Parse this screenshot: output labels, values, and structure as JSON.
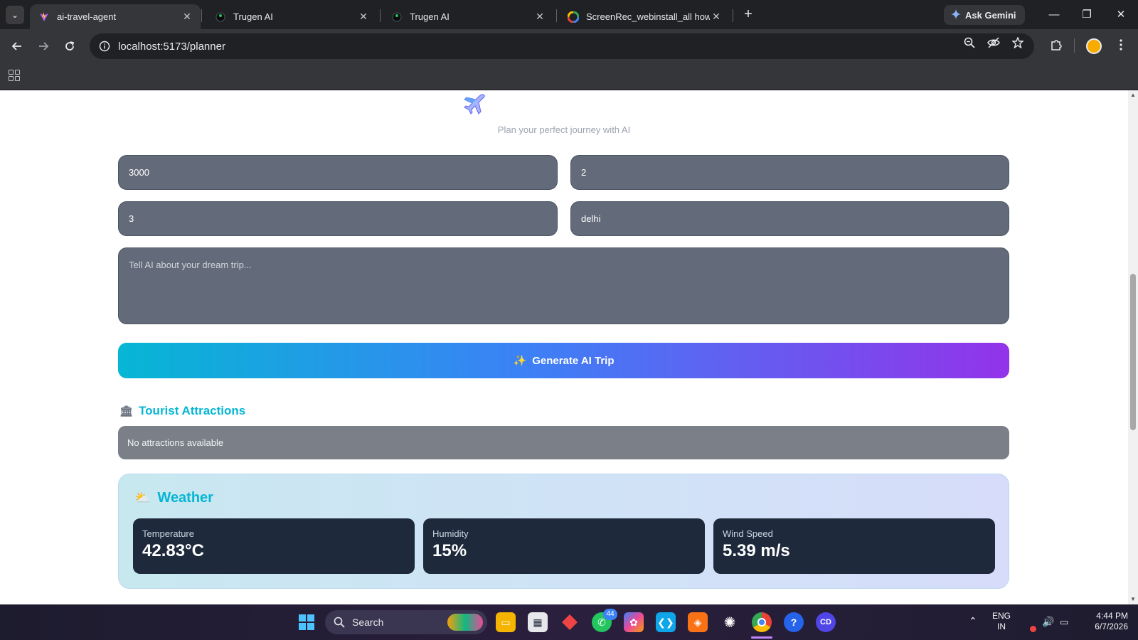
{
  "browser": {
    "tabs": [
      {
        "title": "ai-travel-agent",
        "active": true,
        "favicon": "vite-logo-icon"
      },
      {
        "title": "Trugen AI",
        "active": false,
        "favicon": "trugen-logo-icon"
      },
      {
        "title": "Trugen AI",
        "active": false,
        "favicon": "trugen-logo-icon"
      },
      {
        "title": "ScreenRec_webinstall_all how to",
        "active": false,
        "favicon": "google-logo-icon"
      }
    ],
    "close_glyph": "✕",
    "new_tab_glyph": "+",
    "ask_gemini": "Ask Gemini",
    "url": "localhost:5173/planner",
    "window_controls": {
      "minimize": "—",
      "restore": "❐",
      "close": "✕"
    }
  },
  "page": {
    "tagline": "Plan your perfect journey with AI",
    "fields": {
      "budget_value": "3000",
      "travelers_value": "2",
      "days_value": "3",
      "destination_value": "delhi",
      "dream_trip_placeholder": "Tell AI about your dream trip..."
    },
    "generate_button": {
      "icon": "✨",
      "label": "Generate AI Trip"
    },
    "attractions": {
      "icon": "🏛",
      "title": "Tourist Attractions",
      "empty_text": "No attractions available"
    },
    "weather": {
      "icon": "⛅",
      "title": "Weather",
      "stats": [
        {
          "label": "Temperature",
          "value": "42.83°C"
        },
        {
          "label": "Humidity",
          "value": "15%"
        },
        {
          "label": "Wind Speed",
          "value": "5.39 m/s"
        }
      ]
    }
  },
  "taskbar": {
    "search_label": "Search",
    "whatsapp_badge": "44",
    "language": "ENG",
    "region": "IN",
    "time": "4:44 PM",
    "date": "6/7/2026"
  },
  "colors": {
    "accent_cyan": "#06b6d4",
    "button_gradient_start": "#06b6d4",
    "button_gradient_end": "#9333ea",
    "stat_card": "#1e293b",
    "input_bg": "#636b7a"
  }
}
